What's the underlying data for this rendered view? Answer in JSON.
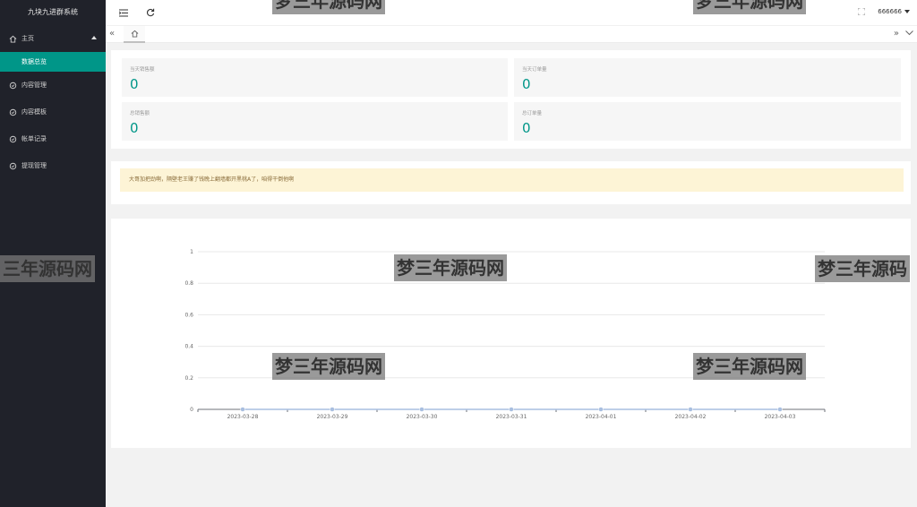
{
  "sidebar": {
    "logo": "九块九进群系统",
    "home": "主页",
    "home_sub": "数据总览",
    "items": [
      {
        "label": "内容管理"
      },
      {
        "label": "内容模板"
      },
      {
        "label": "帐单记录"
      },
      {
        "label": "提现管理"
      }
    ]
  },
  "header": {
    "user": "666666"
  },
  "stats": [
    {
      "label": "当天销售额",
      "value": "0"
    },
    {
      "label": "当天订单量",
      "value": "0"
    },
    {
      "label": "总销售额",
      "value": "0"
    },
    {
      "label": "总订单量",
      "value": "0"
    }
  ],
  "notice": "大哥加把劲啊，隔壁老王赚了钱晚上翻墙都开黑桃A了，咱得干倒他啊",
  "watermark": "梦三年源码网",
  "watermark_partial_left": "三年源码网",
  "watermark_partial_right": "梦三年源码",
  "chart_data": {
    "type": "line",
    "x": [
      "2023-03-28",
      "2023-03-29",
      "2023-03-30",
      "2023-03-31",
      "2023-04-01",
      "2023-04-02",
      "2023-04-03"
    ],
    "series": [
      {
        "values": [
          0,
          0,
          0,
          0,
          0,
          0,
          0
        ]
      }
    ],
    "ylim": [
      0,
      1
    ],
    "yticks": [
      "0",
      "0.2",
      "0.4",
      "0.6",
      "0.8",
      "1"
    ],
    "colors": {
      "line": "#a9bfe0",
      "grid": "#e8e8e8",
      "axis": "#6e7079"
    }
  }
}
